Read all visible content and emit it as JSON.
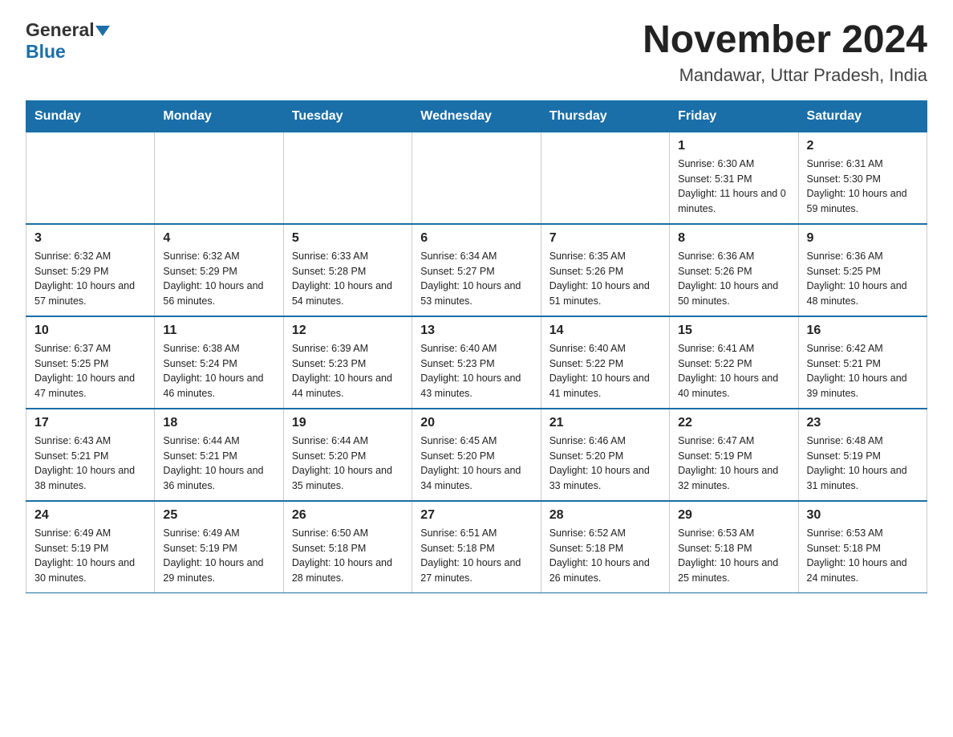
{
  "logo": {
    "general": "General",
    "blue": "Blue"
  },
  "title": "November 2024",
  "subtitle": "Mandawar, Uttar Pradesh, India",
  "weekdays": [
    "Sunday",
    "Monday",
    "Tuesday",
    "Wednesday",
    "Thursday",
    "Friday",
    "Saturday"
  ],
  "weeks": [
    [
      {
        "day": "",
        "info": ""
      },
      {
        "day": "",
        "info": ""
      },
      {
        "day": "",
        "info": ""
      },
      {
        "day": "",
        "info": ""
      },
      {
        "day": "",
        "info": ""
      },
      {
        "day": "1",
        "info": "Sunrise: 6:30 AM\nSunset: 5:31 PM\nDaylight: 11 hours and 0 minutes."
      },
      {
        "day": "2",
        "info": "Sunrise: 6:31 AM\nSunset: 5:30 PM\nDaylight: 10 hours and 59 minutes."
      }
    ],
    [
      {
        "day": "3",
        "info": "Sunrise: 6:32 AM\nSunset: 5:29 PM\nDaylight: 10 hours and 57 minutes."
      },
      {
        "day": "4",
        "info": "Sunrise: 6:32 AM\nSunset: 5:29 PM\nDaylight: 10 hours and 56 minutes."
      },
      {
        "day": "5",
        "info": "Sunrise: 6:33 AM\nSunset: 5:28 PM\nDaylight: 10 hours and 54 minutes."
      },
      {
        "day": "6",
        "info": "Sunrise: 6:34 AM\nSunset: 5:27 PM\nDaylight: 10 hours and 53 minutes."
      },
      {
        "day": "7",
        "info": "Sunrise: 6:35 AM\nSunset: 5:26 PM\nDaylight: 10 hours and 51 minutes."
      },
      {
        "day": "8",
        "info": "Sunrise: 6:36 AM\nSunset: 5:26 PM\nDaylight: 10 hours and 50 minutes."
      },
      {
        "day": "9",
        "info": "Sunrise: 6:36 AM\nSunset: 5:25 PM\nDaylight: 10 hours and 48 minutes."
      }
    ],
    [
      {
        "day": "10",
        "info": "Sunrise: 6:37 AM\nSunset: 5:25 PM\nDaylight: 10 hours and 47 minutes."
      },
      {
        "day": "11",
        "info": "Sunrise: 6:38 AM\nSunset: 5:24 PM\nDaylight: 10 hours and 46 minutes."
      },
      {
        "day": "12",
        "info": "Sunrise: 6:39 AM\nSunset: 5:23 PM\nDaylight: 10 hours and 44 minutes."
      },
      {
        "day": "13",
        "info": "Sunrise: 6:40 AM\nSunset: 5:23 PM\nDaylight: 10 hours and 43 minutes."
      },
      {
        "day": "14",
        "info": "Sunrise: 6:40 AM\nSunset: 5:22 PM\nDaylight: 10 hours and 41 minutes."
      },
      {
        "day": "15",
        "info": "Sunrise: 6:41 AM\nSunset: 5:22 PM\nDaylight: 10 hours and 40 minutes."
      },
      {
        "day": "16",
        "info": "Sunrise: 6:42 AM\nSunset: 5:21 PM\nDaylight: 10 hours and 39 minutes."
      }
    ],
    [
      {
        "day": "17",
        "info": "Sunrise: 6:43 AM\nSunset: 5:21 PM\nDaylight: 10 hours and 38 minutes."
      },
      {
        "day": "18",
        "info": "Sunrise: 6:44 AM\nSunset: 5:21 PM\nDaylight: 10 hours and 36 minutes."
      },
      {
        "day": "19",
        "info": "Sunrise: 6:44 AM\nSunset: 5:20 PM\nDaylight: 10 hours and 35 minutes."
      },
      {
        "day": "20",
        "info": "Sunrise: 6:45 AM\nSunset: 5:20 PM\nDaylight: 10 hours and 34 minutes."
      },
      {
        "day": "21",
        "info": "Sunrise: 6:46 AM\nSunset: 5:20 PM\nDaylight: 10 hours and 33 minutes."
      },
      {
        "day": "22",
        "info": "Sunrise: 6:47 AM\nSunset: 5:19 PM\nDaylight: 10 hours and 32 minutes."
      },
      {
        "day": "23",
        "info": "Sunrise: 6:48 AM\nSunset: 5:19 PM\nDaylight: 10 hours and 31 minutes."
      }
    ],
    [
      {
        "day": "24",
        "info": "Sunrise: 6:49 AM\nSunset: 5:19 PM\nDaylight: 10 hours and 30 minutes."
      },
      {
        "day": "25",
        "info": "Sunrise: 6:49 AM\nSunset: 5:19 PM\nDaylight: 10 hours and 29 minutes."
      },
      {
        "day": "26",
        "info": "Sunrise: 6:50 AM\nSunset: 5:18 PM\nDaylight: 10 hours and 28 minutes."
      },
      {
        "day": "27",
        "info": "Sunrise: 6:51 AM\nSunset: 5:18 PM\nDaylight: 10 hours and 27 minutes."
      },
      {
        "day": "28",
        "info": "Sunrise: 6:52 AM\nSunset: 5:18 PM\nDaylight: 10 hours and 26 minutes."
      },
      {
        "day": "29",
        "info": "Sunrise: 6:53 AM\nSunset: 5:18 PM\nDaylight: 10 hours and 25 minutes."
      },
      {
        "day": "30",
        "info": "Sunrise: 6:53 AM\nSunset: 5:18 PM\nDaylight: 10 hours and 24 minutes."
      }
    ]
  ]
}
